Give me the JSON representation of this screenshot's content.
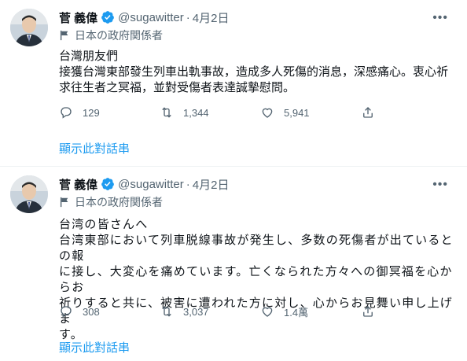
{
  "tweets": [
    {
      "author": {
        "name": "菅 義偉",
        "handle": "@sugawitter"
      },
      "separator": "·",
      "date": "4月2日",
      "label": "日本の政府関係者",
      "body_lines": [
        "台灣朋友們",
        "接獲台灣東部發生列車出軌事故，造成多人死傷的消息，深感痛心。衷心祈",
        "求往生者之冥福，並對受傷者表達誠摯慰問。"
      ],
      "replies": "129",
      "retweets": "1,344",
      "likes": "5,941",
      "thread_link": "顯示此對話串"
    },
    {
      "author": {
        "name": "菅 義偉",
        "handle": "@sugawitter"
      },
      "separator": "·",
      "date": "4月2日",
      "label": "日本の政府関係者",
      "body_lines": [
        "台湾の皆さんへ",
        "台湾東部において列車脱線事故が発生し、多数の死傷者が出ているとの報",
        "に接し、大変心を痛めています。亡くなられた方々への御冥福を心からお",
        "祈りすると共に、被害に遭われた方に対し、心からお見舞い申し上げま",
        "す。"
      ],
      "replies": "308",
      "retweets": "3,037",
      "likes": "1.4萬",
      "thread_link": "顯示此對話串"
    }
  ],
  "colors": {
    "accent": "#1d9bf0",
    "muted": "#536471",
    "text": "#0f1419"
  },
  "icons": [
    "more-icon",
    "verified-icon",
    "flag-icon",
    "reply-icon",
    "retweet-icon",
    "like-icon",
    "share-icon"
  ]
}
